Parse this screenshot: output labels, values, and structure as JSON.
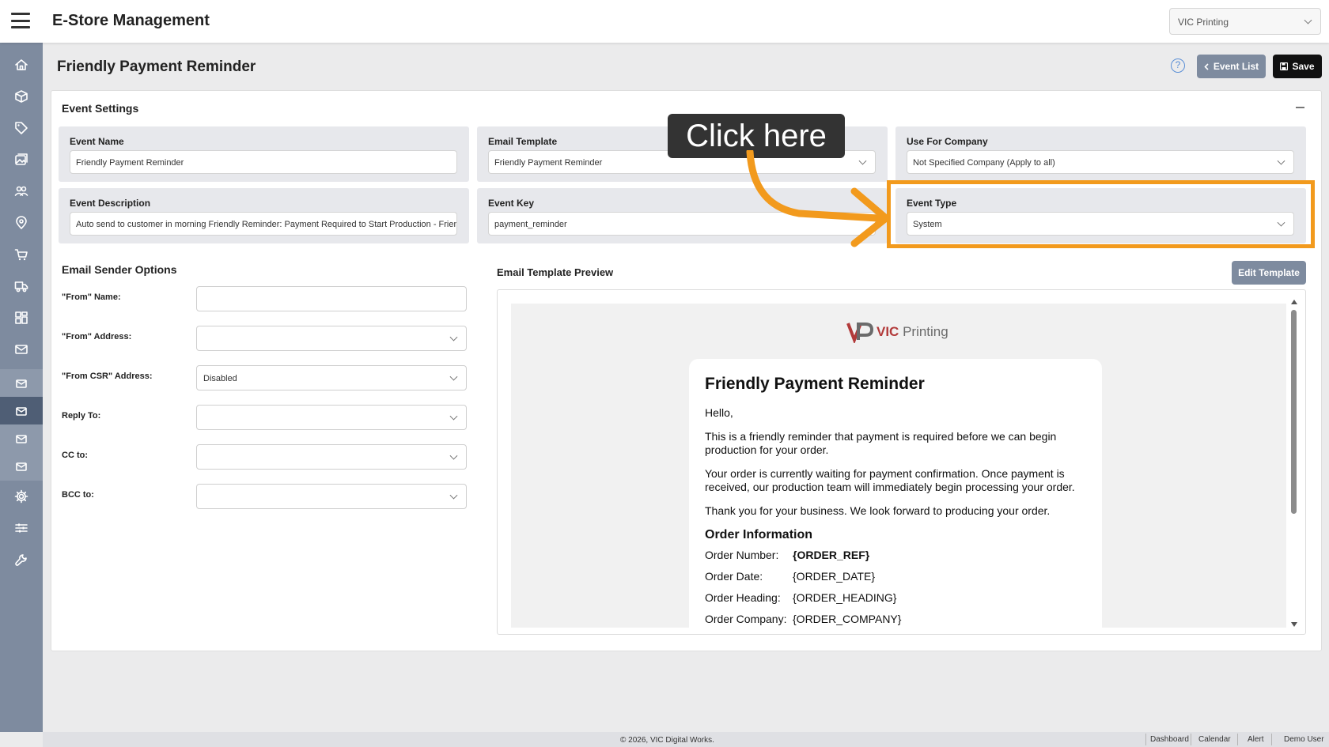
{
  "header": {
    "app_title": "E-Store Management",
    "company_select": "VIC Printing"
  },
  "page": {
    "title": "Friendly Payment Reminder",
    "event_list_label": "Event List",
    "save_label": "Save"
  },
  "event_settings": {
    "title": "Event Settings",
    "event_name": {
      "label": "Event Name",
      "value": "Friendly Payment Reminder"
    },
    "email_template": {
      "label": "Email Template",
      "value": "Friendly Payment Reminder"
    },
    "use_for_company": {
      "label": "Use For Company",
      "value": "Not Specified Company (Apply to all)"
    },
    "event_description": {
      "label": "Event Description",
      "value": "Auto send to customer in morning Friendly Reminder: Payment Required to Start Production - Friendly"
    },
    "event_key": {
      "label": "Event Key",
      "value": "payment_reminder"
    },
    "event_type": {
      "label": "Event Type",
      "value": "System"
    }
  },
  "sender_options": {
    "title": "Email Sender Options",
    "from_name": {
      "label": "\"From\" Name:",
      "value": ""
    },
    "from_address": {
      "label": "\"From\" Address:",
      "value": ""
    },
    "from_csr": {
      "label": "\"From CSR\" Address:",
      "value": "Disabled"
    },
    "reply_to": {
      "label": "Reply To:",
      "value": ""
    },
    "cc_to": {
      "label": "CC to:",
      "value": ""
    },
    "bcc_to": {
      "label": "BCC to:",
      "value": ""
    }
  },
  "preview": {
    "title": "Email Template Preview",
    "edit_label": "Edit Template",
    "logo_brand": "VIC",
    "logo_text": "Printing",
    "email_heading": "Friendly Payment Reminder",
    "greeting": "Hello,",
    "para1": "This is a friendly reminder that payment is required before we can begin production for your order.",
    "para2": "Your order is currently waiting for payment confirmation. Once payment is received, our production team will immediately begin processing your order.",
    "para3": "Thank you for your business. We look forward to producing your order.",
    "order_info_title": "Order Information",
    "order_rows": [
      {
        "key": "Order Number:",
        "value": "{ORDER_REF}"
      },
      {
        "key": "Order Date:",
        "value": "{ORDER_DATE}"
      },
      {
        "key": "Order Heading:",
        "value": "{ORDER_HEADING}"
      },
      {
        "key": "Order Company:",
        "value": "{ORDER_COMPANY}"
      }
    ]
  },
  "callout": {
    "text": "Click here",
    "color": "#f29a1d"
  },
  "footer": {
    "copyright": "© 2026, VIC Digital Works.",
    "links": [
      "Dashboard",
      "Calendar",
      "Alert",
      "Demo User"
    ]
  },
  "sidebar_icons": [
    "home-icon",
    "box-icon",
    "tag-icon",
    "images-icon",
    "users-icon",
    "location-icon",
    "cart-icon",
    "truck-icon",
    "grid-icon",
    "mail-icon",
    "mail-sub-icon",
    "mail-active-icon",
    "mail-sub-icon",
    "mail-sub-icon",
    "gear-icon",
    "sliders-icon",
    "wrench-icon"
  ]
}
